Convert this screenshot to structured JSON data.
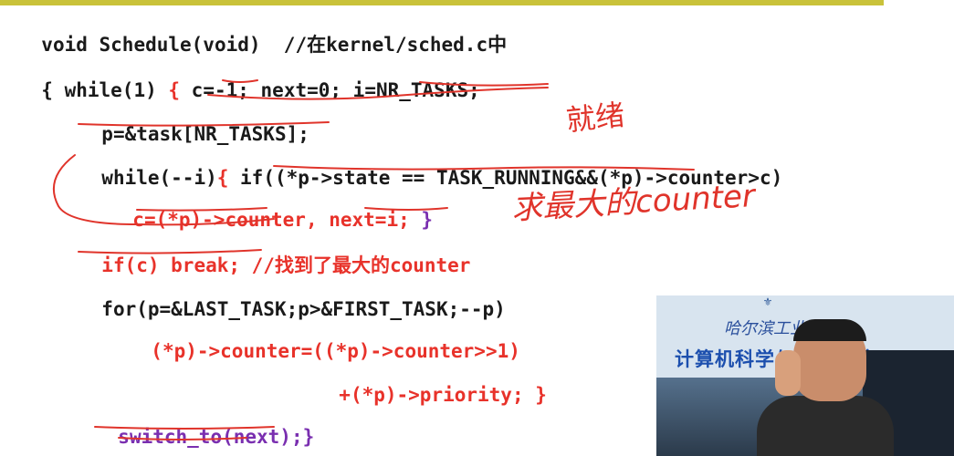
{
  "slide": {
    "lines": [
      {
        "parts": [
          "void Schedule(void)  //",
          "在",
          "kernel/sched.c",
          "中"
        ]
      },
      {
        "parts": [
          "{ while(1) ",
          "{ ",
          "c=-1; next=0; i=NR_TASKS;"
        ]
      },
      {
        "parts": [
          "p=&task[NR_TASKS];"
        ]
      },
      {
        "parts": [
          "while(--i)",
          "{ ",
          "if((*p->state == TASK_RUNNING&&(*p)->counter>c)"
        ]
      },
      {
        "parts": [
          "c=(*p)->counter, next=i; ",
          "}"
        ]
      },
      {
        "parts": [
          "if(c) break; //",
          "找到了最大的",
          "counter"
        ]
      },
      {
        "parts": [
          "for(p=&LAST_TASK;p>&FIRST_TASK;--p)"
        ]
      },
      {
        "parts": [
          "(*p)->counter=((*p)->counter>>1)"
        ]
      },
      {
        "parts": [
          "+(*p)->priority; }"
        ]
      },
      {
        "parts": [
          "switch_to(next);}"
        ]
      }
    ],
    "handwriting": [
      "就绪",
      "求最大的counter"
    ]
  },
  "video": {
    "school": "哈尔滨工业大学",
    "dept": "计算机科学与技术学院"
  },
  "colors": {
    "accent_bar": "#c9c23a",
    "code_red": "#e8322a",
    "code_purple": "#7a2fb0",
    "ink_red": "#e0342b"
  }
}
